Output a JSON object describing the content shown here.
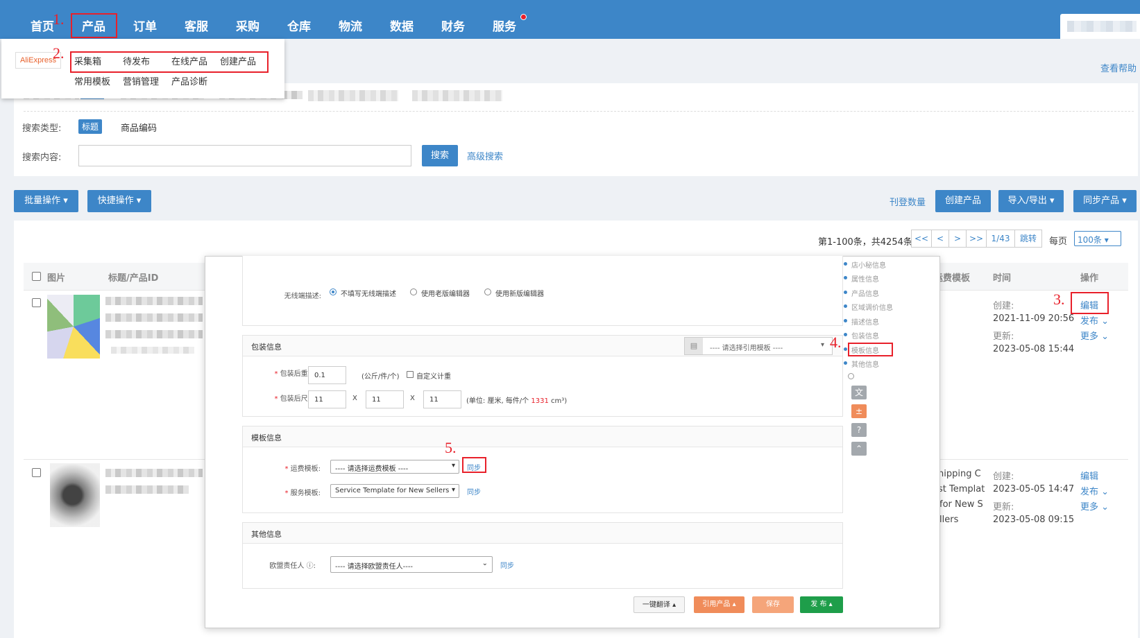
{
  "nav": {
    "items": [
      "首页",
      "产品",
      "订单",
      "客服",
      "采购",
      "仓库",
      "物流",
      "数据",
      "财务",
      "服务"
    ]
  },
  "annotations": [
    "1.",
    "2.",
    "3.",
    "4.",
    "5."
  ],
  "dropdown": {
    "logo": "AliExpress",
    "items": [
      "采集箱",
      "待发布",
      "在线产品",
      "创建产品",
      "常用模板",
      "营销管理",
      "产品诊断"
    ]
  },
  "help_link": "查看帮助",
  "search": {
    "type_label": "搜索类型:",
    "type_selected": "标题",
    "type_other": "商品编码",
    "content_label": "搜索内容:",
    "input_value": "",
    "search_button": "搜索",
    "advanced": "高级搜索"
  },
  "toolbar": {
    "batch": "批量操作",
    "quick": "快捷操作",
    "publish_count": "刊登数量",
    "create": "创建产品",
    "import_export": "导入/导出",
    "sync": "同步产品"
  },
  "pagination": {
    "summary": "第1-100条，共4254条",
    "first": "<<",
    "prev": "<",
    "next": ">",
    "last": ">>",
    "page": "1/43",
    "jump": "跳转",
    "per_page_label": "每页",
    "per_page_value": "100条"
  },
  "table": {
    "headers": [
      "图片",
      "标题/产品ID",
      "运费模板",
      "时间",
      "操作"
    ],
    "rows": [
      {
        "template_lines": [],
        "created_label": "创建:",
        "created": "2021-11-09 20:56",
        "updated_label": "更新:",
        "updated": "2023-05-08 15:44",
        "actions": [
          "编辑",
          "发布",
          "更多"
        ]
      },
      {
        "template_lines": [
          "hipping C",
          "st Templat",
          "for New S",
          "llers"
        ],
        "created_label": "创建:",
        "created": "2023-05-05 14:47",
        "updated_label": "更新:",
        "updated": "2023-05-08 09:15",
        "actions": [
          "编辑",
          "发布",
          "更多"
        ]
      }
    ]
  },
  "modal": {
    "wireless_label": "无线端描述:",
    "wireless_options": [
      "不填写无线端描述",
      "使用老版编辑器",
      "使用新版编辑器"
    ],
    "pack_title": "包装信息",
    "pack_template_placeholder": "---- 请选择引用模板 ----",
    "weight_label": "包装后重量:",
    "weight_value": "0.1",
    "weight_unit": "(公斤/件/个)",
    "custom_weight": "自定义计重",
    "size_label": "包装后尺寸:",
    "size_values": [
      "11",
      "11",
      "11"
    ],
    "size_x": "X",
    "size_unit_prefix": "(单位: 厘米, 每件/个",
    "size_volume": "1331",
    "size_unit_suffix": "cm³)",
    "template_title": "模板信息",
    "shipping_label": "运费模板:",
    "shipping_placeholder": "---- 请选择运费模板 ----",
    "service_label": "服务模板:",
    "service_value": "Service Template for New Sellers",
    "sync": "同步",
    "other_title": "其他信息",
    "eu_label": "欧盟责任人",
    "eu_placeholder": "---- 请选择欧盟责任人----",
    "sidebar": [
      "店小秘信息",
      "属性信息",
      "产品信息",
      "区域调价信息",
      "描述信息",
      "包装信息",
      "模板信息",
      "其他信息"
    ],
    "footer": {
      "translate": "一键翻译",
      "quote": "引用产品",
      "save": "保存",
      "publish": "发 布"
    }
  },
  "colors": {
    "primary": "#3d86c8",
    "annotation": "#e8202a",
    "orange": "#f08c5a",
    "green": "#1e9e4a"
  }
}
